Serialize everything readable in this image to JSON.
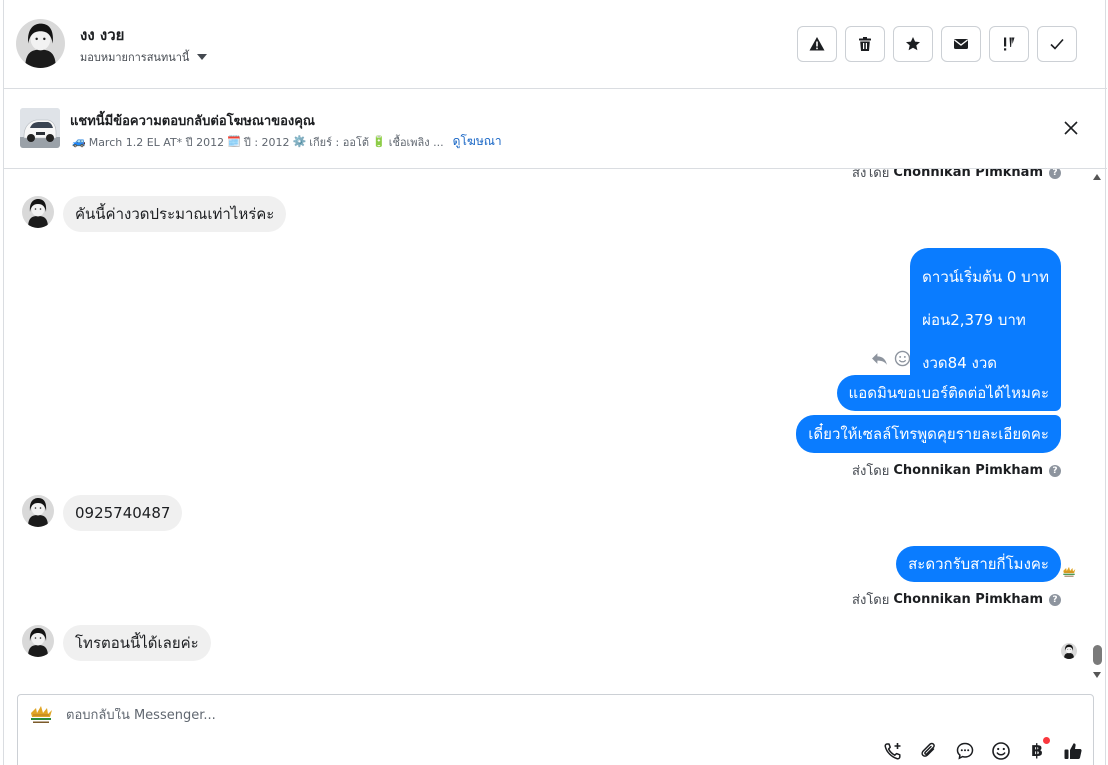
{
  "header": {
    "contact_name": "งง งวย",
    "assign_label": "มอบหมายการสนทนานี้",
    "actions": [
      {
        "name": "spam-icon"
      },
      {
        "name": "trash-icon"
      },
      {
        "name": "star-icon"
      },
      {
        "name": "envelope-icon"
      },
      {
        "name": "follow-up-icon"
      },
      {
        "name": "check-icon"
      }
    ]
  },
  "ad": {
    "title": "แชทนี้มีข้อความตอบกลับต่อโฆษณาของคุณ",
    "car_emoji": "🚙",
    "model": "March 1.2 EL AT* ปี 2012",
    "calendar_emoji": "🗓️",
    "year": "ปี : 2012",
    "gear_emoji": "⚙️",
    "gear": "เกียร์ : ออโต้",
    "fuel_emoji": "🔋",
    "fuel": "เชื้อเพลิง ...",
    "link": "ดูโฆษณา"
  },
  "conversation": {
    "sent_by_prefix": "ส่งโดย",
    "agent_name": "Chonnikan Pimkham",
    "messages": {
      "in_1": "คันนี้ค่างวดประมาณเท่าไหร่คะ",
      "out_1_line_1": "ดาวน์เริ่มต้น 0 บาท",
      "out_1_line_2": "ผ่อน2,379 บาท",
      "out_1_line_3": "งวด84 งวด",
      "out_2": "แอดมินขอเบอร์ติดต่อได้ไหมคะ",
      "out_3": "เดี๋ยวให้เซลล์โทรพูดคุยรายละเอียดคะ",
      "in_2": "0925740487",
      "out_4": "สะดวกรับสายกี่โมงคะ",
      "in_3": "โทรตอนนี้ได้เลยค่ะ"
    }
  },
  "composer": {
    "placeholder": "ตอบกลับใน Messenger...",
    "currency_symbol": "฿",
    "tools": [
      "phone-plus-icon",
      "paperclip-icon",
      "saved-reply-icon",
      "emoji-icon",
      "baht-icon",
      "thumbs-up-icon"
    ]
  }
}
